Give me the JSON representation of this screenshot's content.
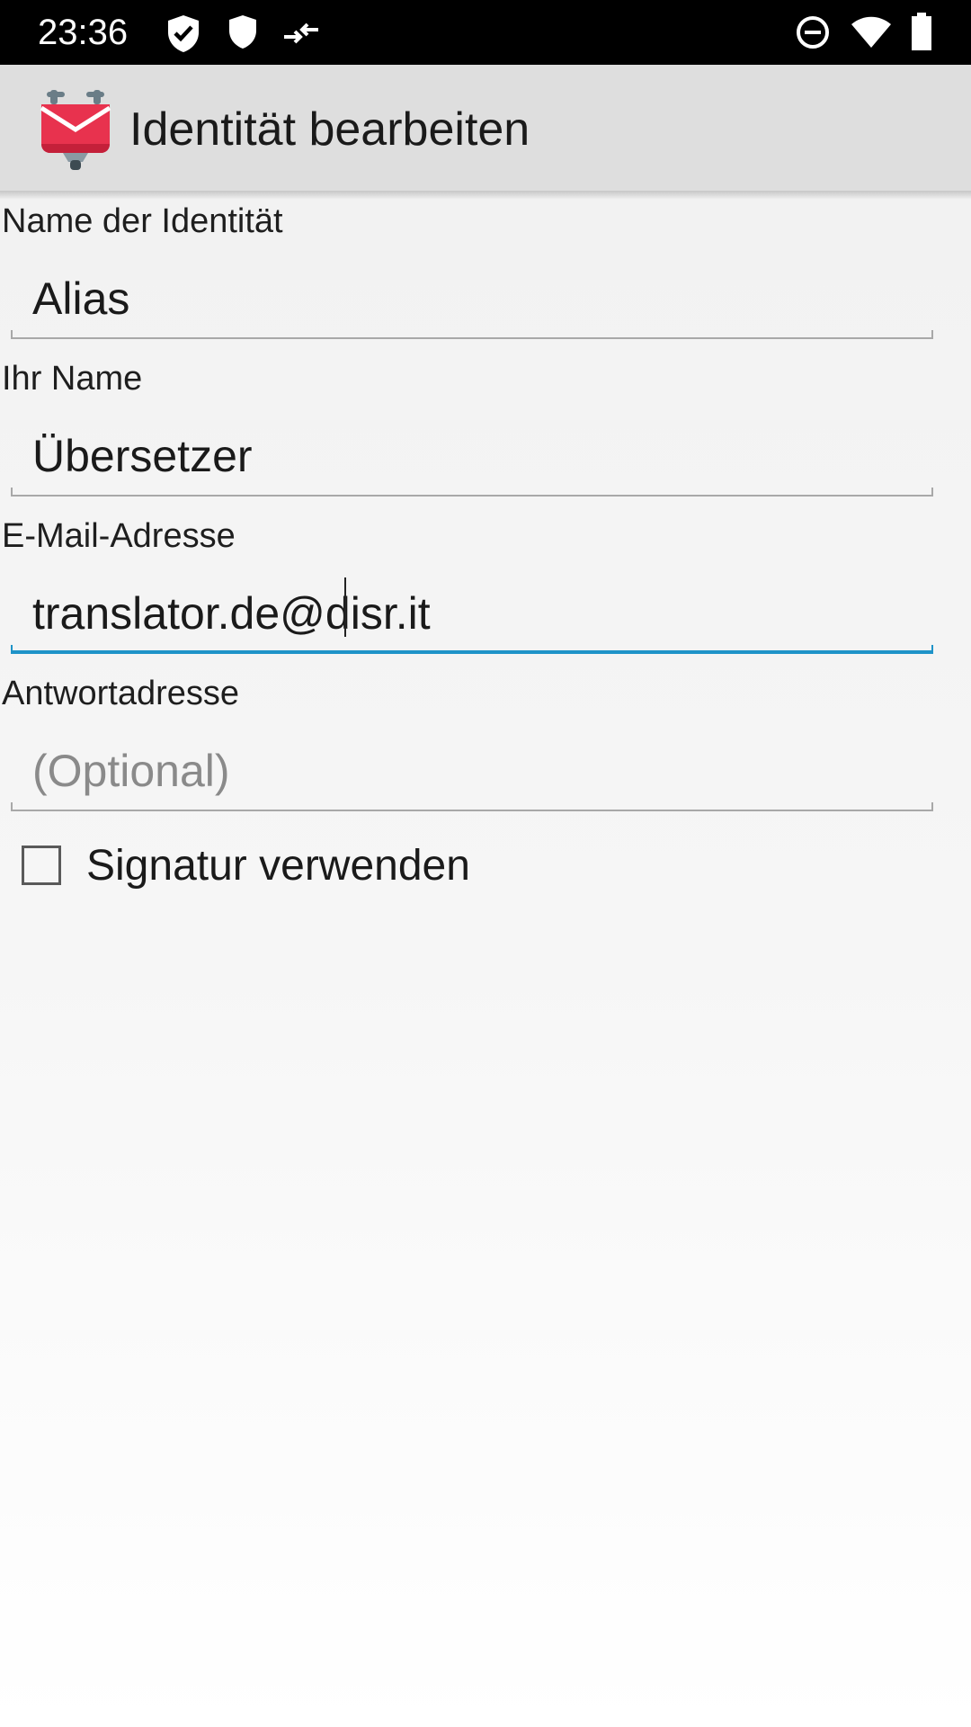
{
  "status_bar": {
    "time": "23:36",
    "left_icons": [
      "shield-check-icon",
      "shield-icon",
      "data-transfer-icon"
    ],
    "right_icons": [
      "do-not-disturb-icon",
      "wifi-icon",
      "battery-icon"
    ]
  },
  "app_bar": {
    "icon": "k9-mail-logo",
    "title": "Identität bearbeiten"
  },
  "form": {
    "identity_name": {
      "label": "Name der Identität",
      "value": "Alias"
    },
    "your_name": {
      "label": "Ihr Name",
      "value": "Übersetzer"
    },
    "email": {
      "label": "E-Mail-Adresse",
      "value": "translator.de@disr.it"
    },
    "reply_to": {
      "label": "Antwortadresse",
      "value": "",
      "placeholder": "(Optional)"
    },
    "signature": {
      "label": "Signatur verwenden",
      "checked": false
    }
  },
  "colors": {
    "status_bar": "#000000",
    "app_bar": "#dedede",
    "focus_accent": "#1e93c8",
    "logo_red": "#e8324e"
  }
}
